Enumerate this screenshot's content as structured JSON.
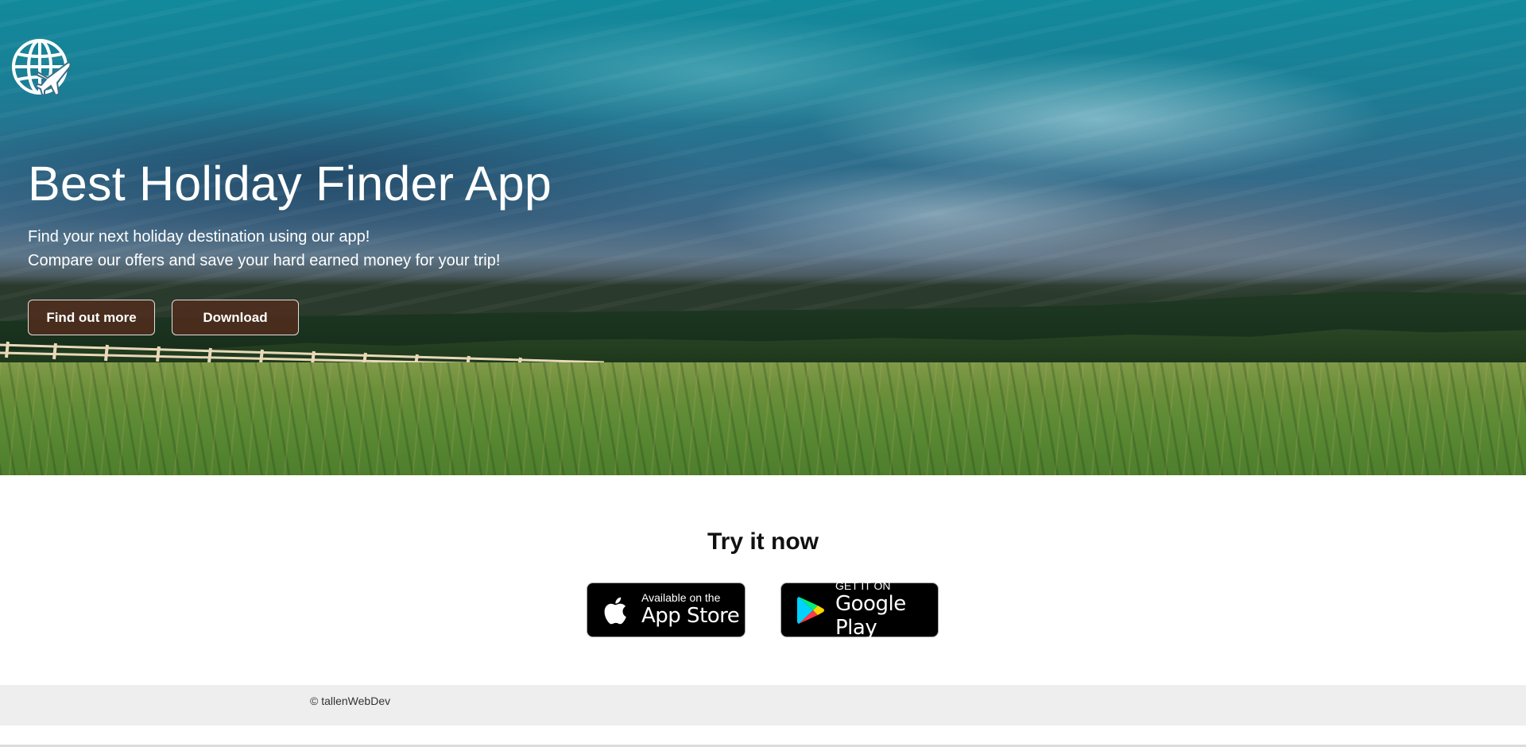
{
  "hero": {
    "title": "Best Holiday Finder App",
    "subtitle_line1": "Find your next holiday destination using our app!",
    "subtitle_line2": "Compare our offers and save your hard earned money for your trip!",
    "find_out_more_label": "Find out more",
    "download_label": "Download",
    "logo_icon": "globe-airplane-icon"
  },
  "try_section": {
    "title": "Try it now",
    "app_store": {
      "small_text": "Available on the",
      "big_text": "App Store",
      "icon": "apple-icon"
    },
    "google_play": {
      "small_text": "GET IT ON",
      "big_text": "Google Play",
      "icon": "google-play-icon"
    }
  },
  "footer": {
    "copyright": "© tallenWebDev"
  },
  "colors": {
    "button_bg": "#4e2c1e",
    "badge_bg": "#000000",
    "footer_bg": "#eeeeee"
  }
}
